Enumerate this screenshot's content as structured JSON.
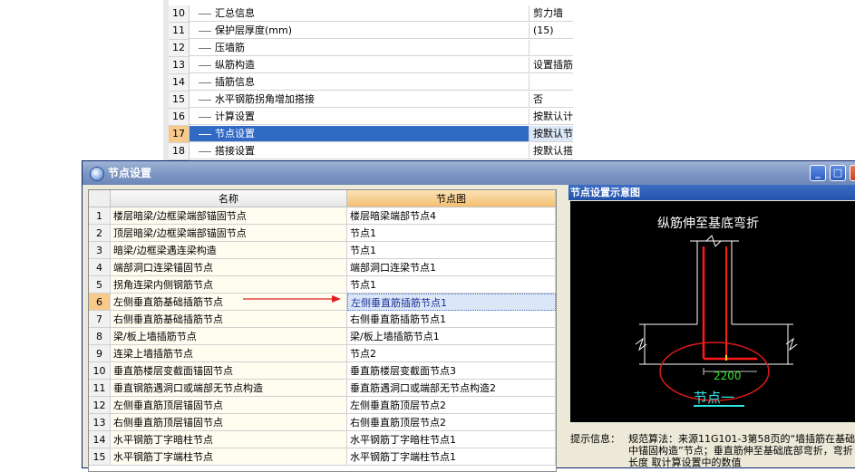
{
  "background_grid": {
    "rows": [
      {
        "num": "10",
        "name": "汇总信息",
        "value": "剪力墙",
        "checkbox": true
      },
      {
        "num": "11",
        "name": "保护层厚度(mm)",
        "value": "(15)",
        "checkbox": true
      },
      {
        "num": "12",
        "name": "压墙筋",
        "value": "",
        "checkbox": true
      },
      {
        "num": "13",
        "name": "纵筋构造",
        "value": "设置插筋",
        "checkbox": true
      },
      {
        "num": "14",
        "name": "插筋信息",
        "value": "",
        "checkbox": true
      },
      {
        "num": "15",
        "name": "水平钢筋拐角增加搭接",
        "value": "否",
        "checkbox": false
      },
      {
        "num": "16",
        "name": "计算设置",
        "value": "按默认计算设置计算",
        "checkbox": false
      },
      {
        "num": "17",
        "name": "节点设置",
        "value": "按默认节点设置计算",
        "checkbox": false,
        "selected": true
      },
      {
        "num": "18",
        "name": "搭接设置",
        "value": "按默认搭接设置计算",
        "checkbox": false
      }
    ]
  },
  "dialog": {
    "title": "节点设置",
    "table": {
      "headers": {
        "name": "名称",
        "node": "节点图"
      },
      "rows": [
        {
          "num": "1",
          "name": "楼层暗梁/边框梁端部锚固节点",
          "node": "楼层暗梁端部节点4"
        },
        {
          "num": "2",
          "name": "顶层暗梁/边框梁端部锚固节点",
          "node": "节点1"
        },
        {
          "num": "3",
          "name": "暗梁/边框梁遇连梁构造",
          "node": "节点1"
        },
        {
          "num": "4",
          "name": "端部洞口连梁锚固节点",
          "node": "端部洞口连梁节点1"
        },
        {
          "num": "5",
          "name": "拐角连梁内侧钢筋节点",
          "node": "节点1"
        },
        {
          "num": "6",
          "name": "左侧垂直筋基础插筋节点",
          "node": "左侧垂直筋插筋节点1",
          "selected": true
        },
        {
          "num": "7",
          "name": "右侧垂直筋基础插筋节点",
          "node": "右侧垂直筋插筋节点1"
        },
        {
          "num": "8",
          "name": "梁/板上墙插筋节点",
          "node": "梁/板上墙插筋节点1"
        },
        {
          "num": "9",
          "name": "连梁上墙插筋节点",
          "node": "节点2"
        },
        {
          "num": "10",
          "name": "垂直筋楼层变截面锚固节点",
          "node": "垂直筋楼层变截面节点3"
        },
        {
          "num": "11",
          "name": "垂直钢筋遇洞口或端部无节点构造",
          "node": "垂直筋遇洞口或端部无节点构造2"
        },
        {
          "num": "12",
          "name": "左侧垂直筋顶层锚固节点",
          "node": "左侧垂直筋顶层节点2"
        },
        {
          "num": "13",
          "name": "右侧垂直筋顶层锚固节点",
          "node": "右侧垂直筋顶层节点2"
        },
        {
          "num": "14",
          "name": "水平钢筋丁字暗柱节点",
          "node": "水平钢筋丁字暗柱节点1"
        },
        {
          "num": "15",
          "name": "水平钢筋丁字端柱节点",
          "node": "水平钢筋丁字端柱节点1"
        }
      ]
    },
    "diagram": {
      "panel_title": "节点设置示意图",
      "caption": "纵筋伸至基底弯折",
      "dimension": "2200",
      "node_label": "节点一"
    },
    "hint": {
      "label": "提示信息：",
      "text": "规范算法：来源11G101-3第58页的“墙插筋在基础中锚固构造”节点；垂直筋伸至基础底部弯折，弯折长度 取计算设置中的数值"
    },
    "window_buttons": {
      "minimize": "_",
      "maximize": "□",
      "close": "×"
    }
  },
  "colors": {
    "selection": "#316ac5",
    "header_orange": "#f4c071",
    "arrow": "#e02020",
    "diagram_bg": "#000000"
  }
}
